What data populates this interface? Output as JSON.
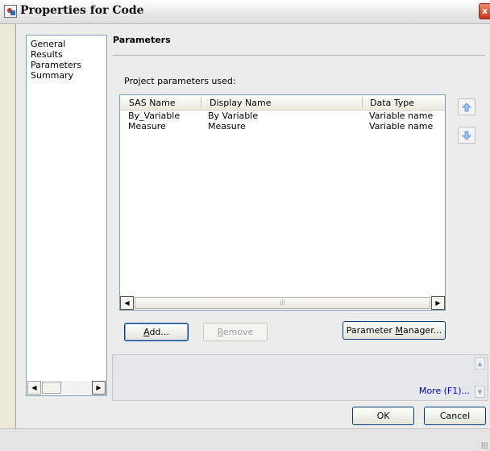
{
  "window": {
    "title": "Properties for Code",
    "close_glyph": "x"
  },
  "nav": {
    "items": [
      "General",
      "Results",
      "Parameters",
      "Summary"
    ],
    "selected": "Parameters"
  },
  "section": {
    "title": "Parameters",
    "caption": "Project parameters used:"
  },
  "table": {
    "columns": [
      "SAS Name",
      "Display Name",
      "Data Type"
    ],
    "rows": [
      [
        "By_Variable",
        "By Variable",
        "Variable name"
      ],
      [
        "Measure",
        "Measure",
        "Variable name"
      ]
    ]
  },
  "buttons": {
    "add": {
      "pre": "",
      "key": "A",
      "post": "dd..."
    },
    "remove": {
      "pre": "",
      "key": "R",
      "post": "emove"
    },
    "manager": {
      "pre": "Parameter ",
      "key": "M",
      "post": "anager..."
    },
    "ok": "OK",
    "cancel": "Cancel"
  },
  "description": {
    "more_link": "More (F1)..."
  },
  "colors": {
    "link": "#0000ff",
    "arrow_icon": "#4a90e2",
    "button_border": "#003c74"
  },
  "icons": {
    "move_up": "arrow-up-icon",
    "move_down": "arrow-down-icon"
  }
}
